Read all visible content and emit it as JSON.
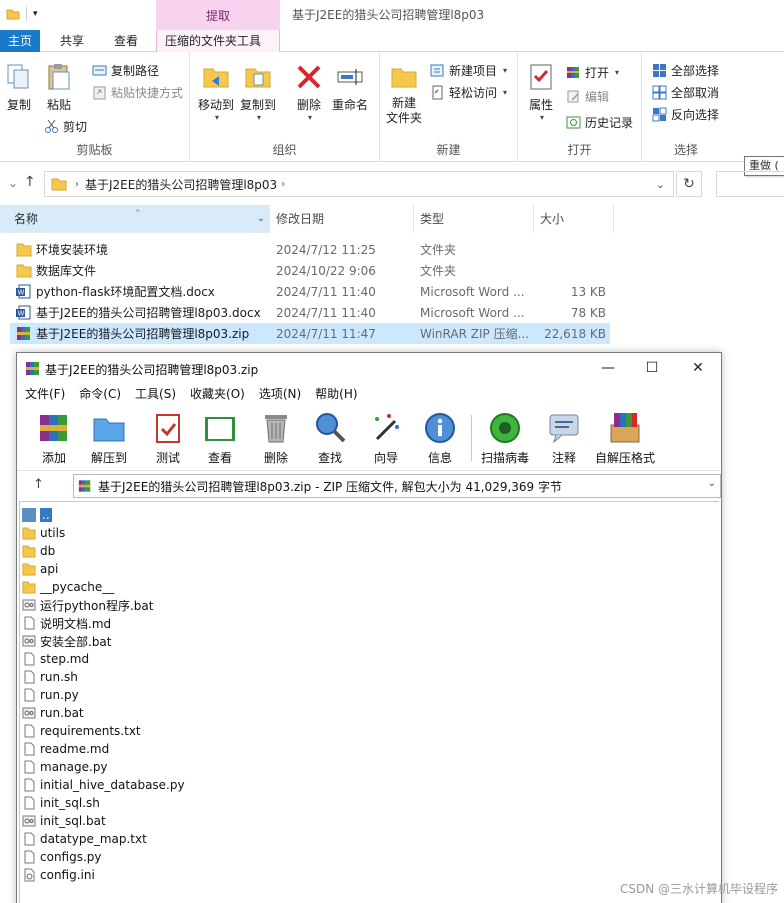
{
  "explorer": {
    "window_title": "基于J2EE的猎头公司招聘管理l8p03",
    "context_tab_group": "提取",
    "tabs": [
      {
        "label": "主页"
      },
      {
        "label": "共享"
      },
      {
        "label": "查看"
      },
      {
        "label": "压缩的文件夹工具"
      }
    ],
    "ribbon": {
      "clipboard": {
        "label": "剪贴板",
        "copy": "复制",
        "paste": "粘贴",
        "copy_path": "复制路径",
        "paste_shortcut": "粘贴快捷方式",
        "cut": "剪切"
      },
      "organize": {
        "label": "组织",
        "move_to": "移动到",
        "copy_to": "复制到",
        "delete": "删除",
        "rename": "重命名"
      },
      "new": {
        "label": "新建",
        "new_folder": "新建\n文件夹",
        "new_item": "新建项目",
        "easy_access": "轻松访问"
      },
      "open": {
        "label": "打开",
        "properties": "属性",
        "open": "打开",
        "edit": "编辑",
        "history": "历史记录"
      },
      "select": {
        "label": "选择",
        "select_all": "全部选择",
        "select_none": "全部取消",
        "invert": "反向选择"
      }
    },
    "address": {
      "crumb": "基于J2EE的猎头公司招聘管理l8p03"
    },
    "tooltip": "重做 (",
    "columns": {
      "name": "名称",
      "date": "修改日期",
      "type": "类型",
      "size": "大小"
    },
    "files": [
      {
        "name": "环境安装环境",
        "date": "2024/7/12 11:25",
        "type": "文件夹",
        "size": "",
        "kind": "folder"
      },
      {
        "name": "数据库文件",
        "date": "2024/10/22 9:06",
        "type": "文件夹",
        "size": "",
        "kind": "folder"
      },
      {
        "name": "python-flask环境配置文档.docx",
        "date": "2024/7/11 11:40",
        "type": "Microsoft Word ...",
        "size": "13 KB",
        "kind": "word"
      },
      {
        "name": "基于J2EE的猎头公司招聘管理l8p03.docx",
        "date": "2024/7/11 11:40",
        "type": "Microsoft Word ...",
        "size": "78 KB",
        "kind": "word"
      },
      {
        "name": "基于J2EE的猎头公司招聘管理l8p03.zip",
        "date": "2024/7/11 11:47",
        "type": "WinRAR ZIP 压缩...",
        "size": "22,618 KB",
        "kind": "zip"
      }
    ]
  },
  "winrar": {
    "title": "基于J2EE的猎头公司招聘管理l8p03.zip",
    "menu": [
      "文件(F)",
      "命令(C)",
      "工具(S)",
      "收藏夹(O)",
      "选项(N)",
      "帮助(H)"
    ],
    "toolbar": [
      "添加",
      "解压到",
      "测试",
      "查看",
      "删除",
      "查找",
      "向导",
      "信息",
      "扫描病毒",
      "注释",
      "自解压格式"
    ],
    "path": "基于J2EE的猎头公司招聘管理l8p03.zip - ZIP 压缩文件, 解包大小为 41,029,369 字节",
    "items": [
      {
        "name": "..",
        "kind": "updir"
      },
      {
        "name": "utils",
        "kind": "folder"
      },
      {
        "name": "db",
        "kind": "folder"
      },
      {
        "name": "api",
        "kind": "folder"
      },
      {
        "name": "__pycache__",
        "kind": "folder"
      },
      {
        "name": "运行python程序.bat",
        "kind": "bat"
      },
      {
        "name": "说明文档.md",
        "kind": "file"
      },
      {
        "name": "安装全部.bat",
        "kind": "bat"
      },
      {
        "name": "step.md",
        "kind": "file"
      },
      {
        "name": "run.sh",
        "kind": "file"
      },
      {
        "name": "run.py",
        "kind": "file"
      },
      {
        "name": "run.bat",
        "kind": "bat"
      },
      {
        "name": "requirements.txt",
        "kind": "file"
      },
      {
        "name": "readme.md",
        "kind": "file"
      },
      {
        "name": "manage.py",
        "kind": "file"
      },
      {
        "name": "initial_hive_database.py",
        "kind": "file"
      },
      {
        "name": "init_sql.sh",
        "kind": "file"
      },
      {
        "name": "init_sql.bat",
        "kind": "bat"
      },
      {
        "name": "datatype_map.txt",
        "kind": "file"
      },
      {
        "name": "configs.py",
        "kind": "file"
      },
      {
        "name": "config.ini",
        "kind": "ini"
      }
    ]
  },
  "watermark": "CSDN @三水计算机毕设程序",
  "colors": {
    "accent": "#1979ca",
    "context_tab": "#f7d3ef",
    "selection": "#cce8ff",
    "folder": "#f5c84c"
  }
}
